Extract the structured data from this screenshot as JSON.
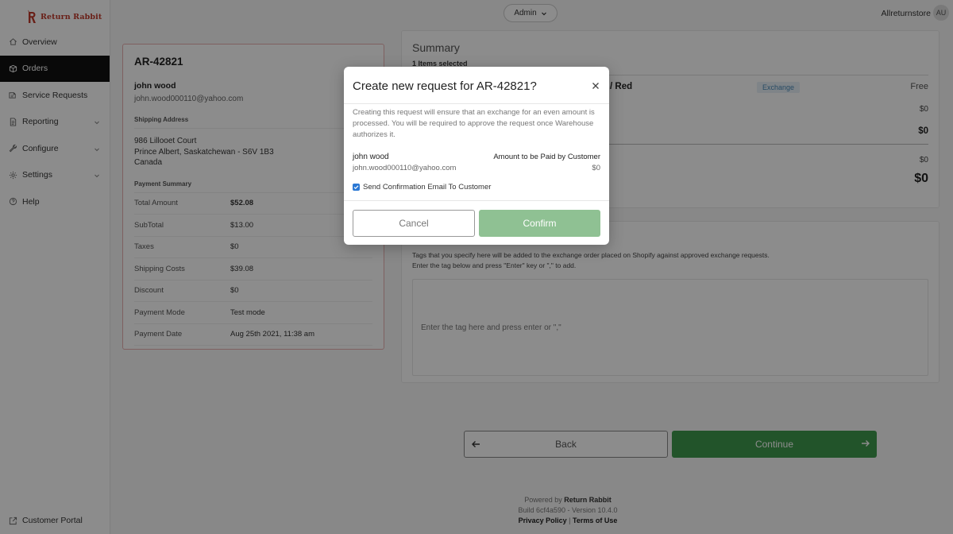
{
  "app": {
    "brand": "Return Rabbit"
  },
  "sidebar": {
    "items": [
      {
        "label": "Overview",
        "icon": "home-icon"
      },
      {
        "label": "Orders",
        "icon": "box-icon",
        "active": true
      },
      {
        "label": "Service Requests",
        "icon": "service-requests-icon"
      },
      {
        "label": "Reporting",
        "icon": "report-icon",
        "expandable": true
      },
      {
        "label": "Configure",
        "icon": "wrench-icon",
        "expandable": true
      },
      {
        "label": "Settings",
        "icon": "gear-icon",
        "expandable": true
      },
      {
        "label": "Help",
        "icon": "help-icon"
      }
    ],
    "bottom": {
      "label": "Customer Portal",
      "icon": "external-link-icon"
    }
  },
  "topbar": {
    "role": "Admin",
    "store": "Allreturnstore",
    "avatar": "AU"
  },
  "order": {
    "id": "AR-42821",
    "customer_name": "john wood",
    "customer_email": "john.wood000110@yahoo.com",
    "shipping_label": "Shipping Address",
    "address": [
      "986 Lillooet Court",
      "Prince Albert, Saskatchewan - S6V 1B3",
      "Canada"
    ],
    "payment_label": "Payment Summary",
    "payment": [
      {
        "k": "Total Amount",
        "v": "$52.08",
        "bold": true
      },
      {
        "k": "SubTotal",
        "v": "$13.00"
      },
      {
        "k": "Taxes",
        "v": "$0"
      },
      {
        "k": "Shipping Costs",
        "v": "$39.08"
      },
      {
        "k": "Discount",
        "v": "$0"
      },
      {
        "k": "Payment Mode",
        "v": "Test mode"
      },
      {
        "k": "Payment Date",
        "v": "Aug 25th 2021, 11:38 am"
      }
    ]
  },
  "summary": {
    "title": "Summary",
    "items_selected": "1 Items selected",
    "item_variant": "/ Red",
    "badge": "Exchange",
    "price": "Free",
    "values": [
      "$0",
      "$0",
      "$0",
      "$0"
    ]
  },
  "tags": {
    "description_line1": "Tags that you specify here will be added to the exchange order placed on Shopify against approved exchange requests.",
    "description_line2": "Enter the tag below and press \"Enter\" key or \",\" to add.",
    "placeholder": "Enter the tag here and press enter or \",\""
  },
  "nav_buttons": {
    "back": "Back",
    "continue": "Continue"
  },
  "footer": {
    "powered_prefix": "Powered by",
    "powered_brand": "Return Rabbit",
    "build": "Build 6cf4a590 - Version 10.4.0",
    "privacy": "Privacy Policy",
    "separator": "|",
    "terms": "Terms of Use"
  },
  "modal": {
    "title": "Create new request for AR-42821?",
    "description": "Creating this request will ensure that an exchange for an even amount is processed. You will be required to approve the request once Warehouse authorizes it.",
    "customer_name": "john wood",
    "customer_email": "john.wood000110@yahoo.com",
    "amount_label": "Amount to be Paid by Customer",
    "amount": "$0",
    "checkbox_label": "Send Confirmation Email To Customer",
    "checkbox_checked": true,
    "cancel": "Cancel",
    "confirm": "Confirm"
  },
  "colors": {
    "brand": "#c0392b",
    "primary_green": "#3f9a4d",
    "confirm_green": "#8fc193",
    "checkbox_blue": "#2b78d4"
  }
}
